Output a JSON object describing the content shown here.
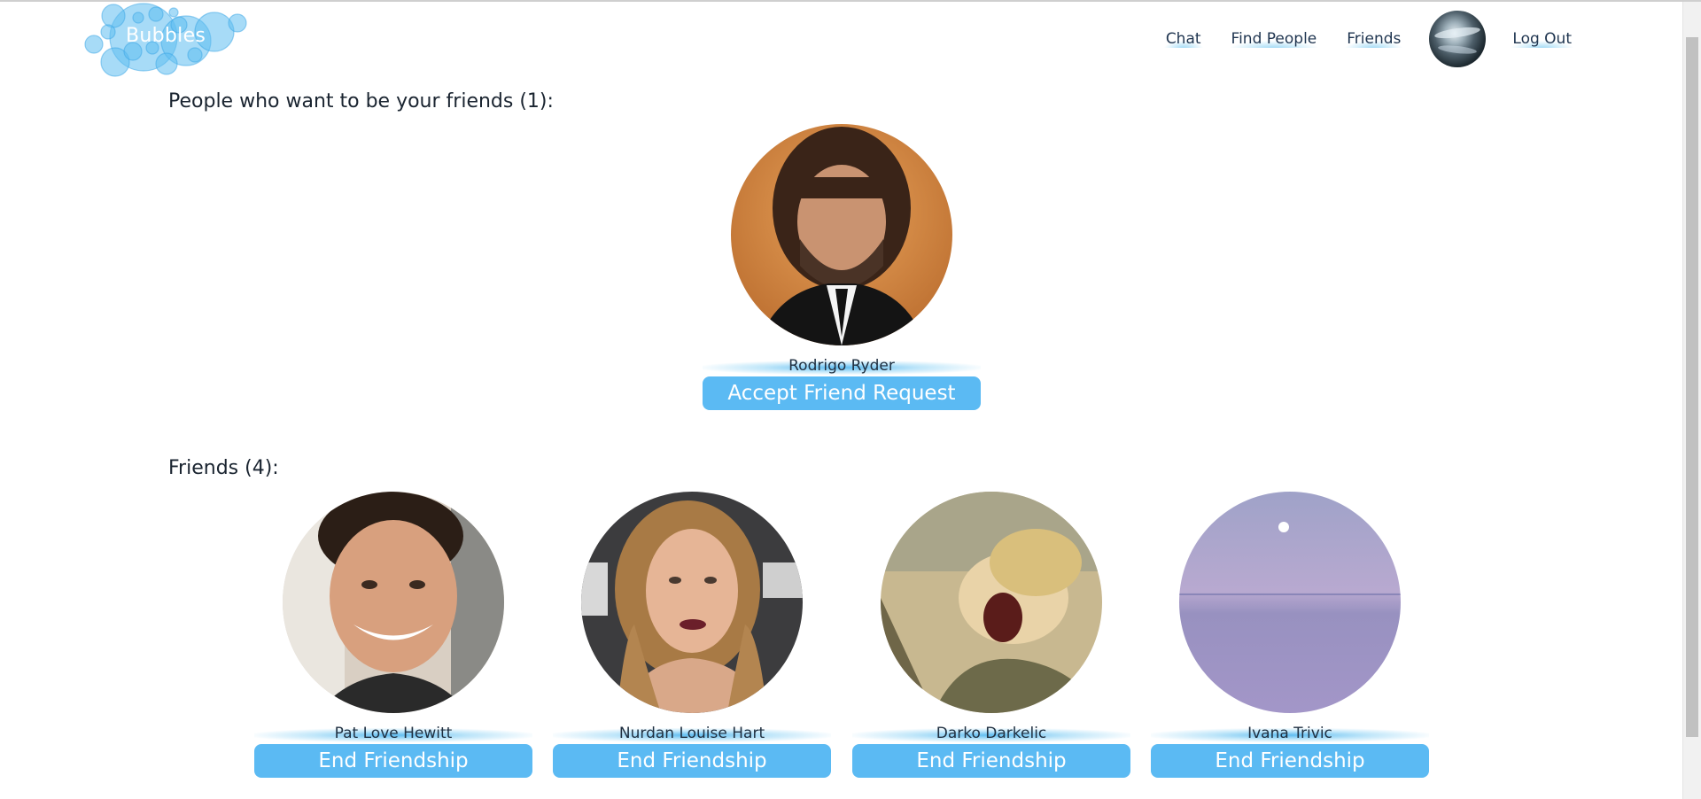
{
  "app": {
    "logo_text": "Bubbles"
  },
  "nav": {
    "chat": "Chat",
    "find_people": "Find People",
    "friends": "Friends",
    "logout": "Log Out"
  },
  "requests": {
    "title": "People who want to be your friends (1):",
    "items": [
      {
        "name": "Rodrigo Ryder",
        "action": "Accept Friend Request"
      }
    ]
  },
  "friends": {
    "title": "Friends (4):",
    "items": [
      {
        "name": "Pat Love Hewitt",
        "action": "End Friendship"
      },
      {
        "name": "Nurdan Louise Hart",
        "action": "End Friendship"
      },
      {
        "name": "Darko Darkelic",
        "action": "End Friendship"
      },
      {
        "name": "Ivana Trivic",
        "action": "End Friendship"
      }
    ]
  },
  "colors": {
    "button": "#5bbaf3",
    "accent_glow": "#56b9f0",
    "logo_bubble": "#6cc3f1"
  }
}
